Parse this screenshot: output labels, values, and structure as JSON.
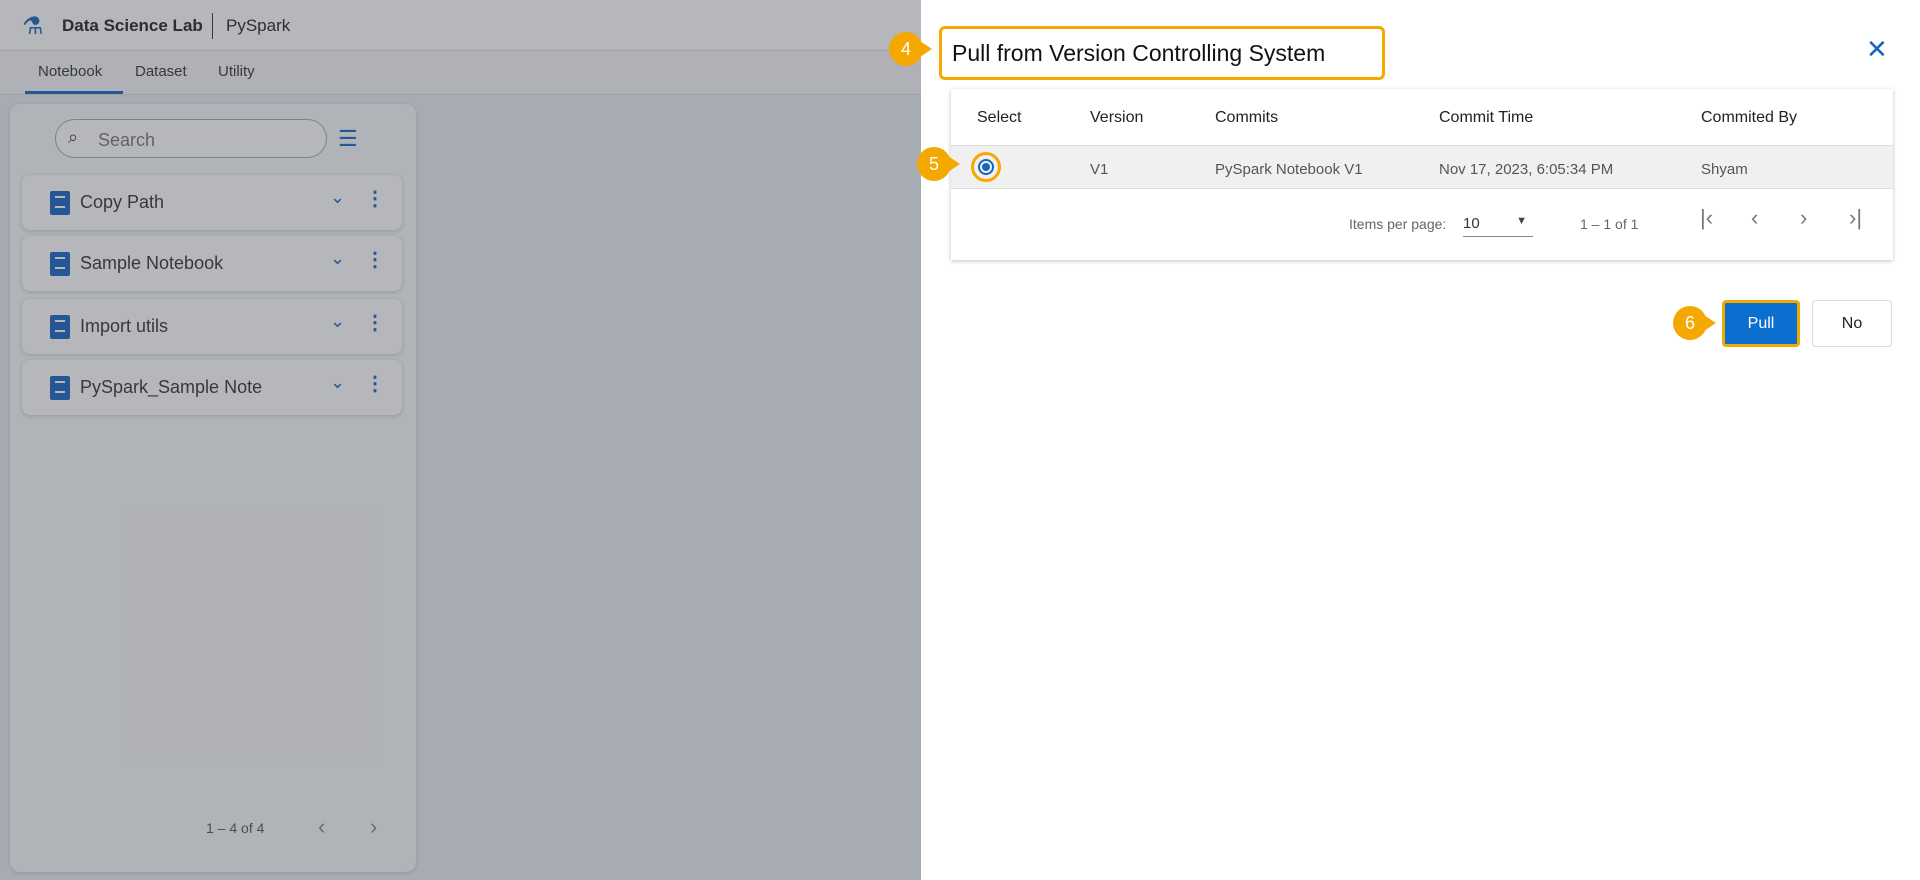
{
  "header": {
    "app_name": "Data Science Lab",
    "module": "PySpark"
  },
  "tabs": [
    {
      "label": "Notebook",
      "active": true
    },
    {
      "label": "Dataset"
    },
    {
      "label": "Utility"
    }
  ],
  "sidebar": {
    "search_placeholder": "Search",
    "items": [
      {
        "label": "Copy Path"
      },
      {
        "label": "Sample Notebook"
      },
      {
        "label": "Import utils"
      },
      {
        "label": "PySpark_Sample Note"
      }
    ],
    "pagination": "1 – 4 of 4"
  },
  "dialog": {
    "title": "Pull from Version Controlling System",
    "columns": [
      "Select",
      "Version",
      "Commits",
      "Commit Time",
      "Commited By"
    ],
    "rows": [
      {
        "selected": true,
        "version": "V1",
        "commit": "PySpark Notebook V1",
        "time": "Nov 17, 2023, 6:05:34 PM",
        "by": "Shyam"
      }
    ],
    "items_per_page_label": "Items per page:",
    "items_per_page": "10",
    "range": "1 – 1 of 1",
    "pull_label": "Pull",
    "no_label": "No"
  },
  "badges": {
    "title": "4",
    "radio": "5",
    "pull": "6"
  },
  "colors": {
    "accent": "#1565c0",
    "highlight": "#f5a800",
    "primary_button": "#0b6fcf"
  }
}
